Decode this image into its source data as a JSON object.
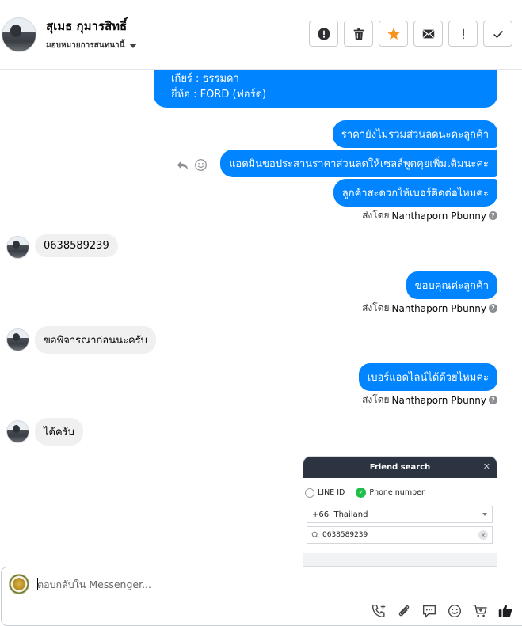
{
  "header": {
    "contact_name": "สุเมธ กุมารสิทธิ์",
    "assignee_label": "มอบหมายการสนทนานี้",
    "toolbar": [
      {
        "name": "spam-button",
        "icon": "alert-circle-icon"
      },
      {
        "name": "delete-button",
        "icon": "trash-icon"
      },
      {
        "name": "star-button",
        "icon": "star-icon"
      },
      {
        "name": "mark-unread-button",
        "icon": "envelope-icon"
      },
      {
        "name": "follow-up-button",
        "icon": "exclamation-icon"
      },
      {
        "name": "done-button",
        "icon": "check-icon"
      }
    ]
  },
  "conversation": {
    "top_bubble": {
      "line1": "เกียร์ : ธรรมดา",
      "line2": "ยี่ห้อ : FORD (ฟอร์ด)"
    },
    "messages": [
      {
        "id": "out-1",
        "text": "ราคายังไม่รวมส่วนลดนะคะลูกค้า"
      },
      {
        "id": "out-2",
        "text": "แอดมินขอประสานราคาส่วนลดให้เซลล์พูดคุยเพิ่มเติมนะคะ"
      },
      {
        "id": "out-3",
        "text": "ลูกค้าสะดวกให้เบอร์ติดต่อไหมคะ"
      },
      {
        "id": "in-1",
        "text": "0638589239"
      },
      {
        "id": "out-4",
        "text": "ขอบคุณค่ะลูกค้า"
      },
      {
        "id": "in-2",
        "text": "ขอพิจารณาก่อนนะครับ"
      },
      {
        "id": "out-5",
        "text": "เบอร์แอดไลน์ได้ด้วยไหมคะ"
      },
      {
        "id": "in-3",
        "text": "ได้ครับ"
      }
    ],
    "sent_by_prefix": "ส่งโดย",
    "sent_by_name": "Nanthaporn Pbunny",
    "help_glyph": "?",
    "line_screenshot": {
      "title": "Friend search",
      "close_glyph": "✕",
      "option_line_id": "LINE ID",
      "option_phone": "Phone number",
      "selected_option": "Phone number",
      "country_code": "+66",
      "country_name": "Thailand",
      "search_value": "0638589239",
      "clear_glyph": "✕"
    }
  },
  "composer": {
    "placeholder": "ตอบกลับใน Messenger...",
    "tools": [
      "phone-plus-icon",
      "paperclip-icon",
      "saved-reply-icon",
      "emoji-icon",
      "cart-icon",
      "thumbs-up-icon"
    ]
  },
  "colors": {
    "outgoing_bubble": "#0084ff",
    "incoming_bubble": "#f0f0f0",
    "star_accent": "#f7931e",
    "line_header": "#2c3442",
    "line_check": "#1fbf4a"
  }
}
